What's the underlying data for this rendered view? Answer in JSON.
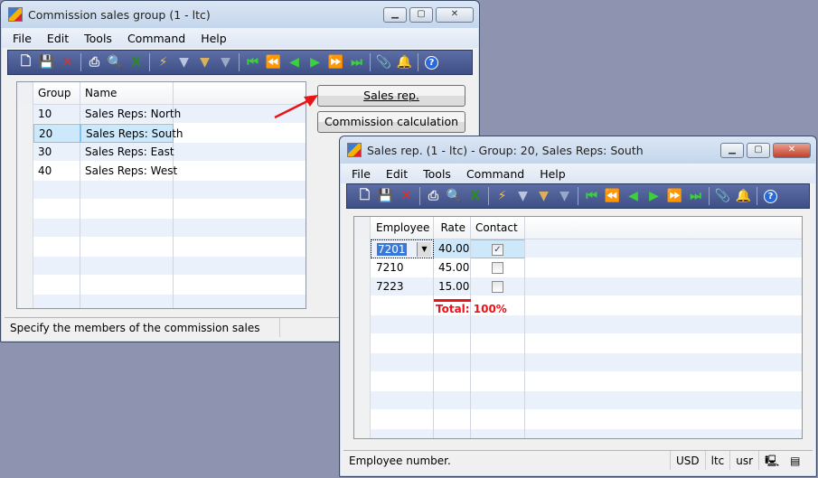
{
  "main_window": {
    "title": "Commission sales group (1 - ltc)",
    "menu": [
      "File",
      "Edit",
      "Tools",
      "Command",
      "Help"
    ],
    "columns": [
      "Group",
      "Name"
    ],
    "rows": [
      [
        "10",
        "Sales Reps: North"
      ],
      [
        "20",
        "Sales Reps: South"
      ],
      [
        "30",
        "Sales Reps: East"
      ],
      [
        "40",
        "Sales Reps: West"
      ]
    ],
    "selected_row": 1,
    "buttons": {
      "sales_rep": "Sales rep.",
      "commission_calc": "Commission calculation"
    },
    "status": "Specify the members of the commission sales group a..."
  },
  "detail_window": {
    "title": "Sales rep. (1 - ltc) - Group: 20, Sales Reps: South",
    "menu": [
      "File",
      "Edit",
      "Tools",
      "Command",
      "Help"
    ],
    "columns": [
      "Employee",
      "Rate",
      "Contact"
    ],
    "rows": [
      {
        "employee": "7201",
        "rate": "40.00",
        "contact": true
      },
      {
        "employee": "7210",
        "rate": "45.00",
        "contact": false
      },
      {
        "employee": "7223",
        "rate": "15.00",
        "contact": false
      }
    ],
    "annotation": "Total: 100%",
    "status": {
      "text": "Employee number.",
      "currency": "USD",
      "company": "ltc",
      "user": "usr"
    }
  },
  "toolbar_icons": [
    "new-icon",
    "save-icon",
    "delete-icon",
    "|",
    "print-icon",
    "print-preview-icon",
    "excel-icon",
    "|",
    "filter-by-selection-icon",
    "filter-by-grid-icon",
    "advanced-filter-icon",
    "remove-filter-icon",
    "|",
    "first-record-icon",
    "previous-page-icon",
    "previous-record-icon",
    "next-record-icon",
    "next-page-icon",
    "last-record-icon",
    "|",
    "document-handling-icon",
    "alert-icon",
    "|",
    "help-icon"
  ],
  "colors": {
    "annotation": "#e8141a",
    "toolbar": "#4a5b93",
    "selection": "#cde8fb"
  }
}
